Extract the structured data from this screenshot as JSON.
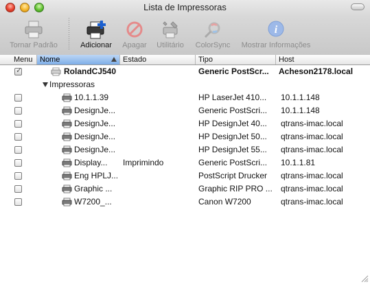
{
  "window": {
    "title": "Lista de Impressoras"
  },
  "toolbar": {
    "buttons": [
      {
        "label": "Tornar Padrão",
        "icon": "printer-icon",
        "enabled": false
      },
      {
        "label": "Adicionar",
        "icon": "add-printer-icon",
        "enabled": true
      },
      {
        "label": "Apagar",
        "icon": "delete-icon",
        "enabled": false
      },
      {
        "label": "Utilitário",
        "icon": "utility-icon",
        "enabled": false
      },
      {
        "label": "ColorSync",
        "icon": "colorsync-icon",
        "enabled": false
      },
      {
        "label": "Mostrar Informações",
        "icon": "info-icon",
        "enabled": false
      }
    ]
  },
  "table": {
    "columns": [
      "Menu",
      "Nome",
      "Estado",
      "Tipo",
      "Host"
    ],
    "sorted_column": "Nome",
    "top_row": {
      "name": "RolandCJ540",
      "status": "",
      "type": "Generic PostScr...",
      "host": "Acheson2178.local",
      "checked": true
    },
    "group_label": "Impressoras",
    "rows": [
      {
        "name": "10.1.1.39",
        "status": "",
        "type": "HP LaserJet 410...",
        "host": "10.1.1.148"
      },
      {
        "name": "DesignJe...",
        "status": "",
        "type": "Generic PostScri...",
        "host": "10.1.1.148"
      },
      {
        "name": "DesignJe...",
        "status": "",
        "type": "HP DesignJet 40...",
        "host": "qtrans-imac.local"
      },
      {
        "name": "DesignJe...",
        "status": "",
        "type": "HP DesignJet 50...",
        "host": "qtrans-imac.local"
      },
      {
        "name": "DesignJe...",
        "status": "",
        "type": "HP DesignJet 55...",
        "host": "qtrans-imac.local"
      },
      {
        "name": "Display...",
        "status": "Imprimindo",
        "type": "Generic PostScri...",
        "host": "10.1.1.81"
      },
      {
        "name": "Eng HPLJ...",
        "status": "",
        "type": "PostScript Drucker",
        "host": "qtrans-imac.local"
      },
      {
        "name": "Graphic ...",
        "status": "",
        "type": "Graphic RIP PRO ...",
        "host": "qtrans-imac.local"
      },
      {
        "name": "W7200_...",
        "status": "",
        "type": "Canon W7200",
        "host": "qtrans-imac.local"
      }
    ]
  }
}
